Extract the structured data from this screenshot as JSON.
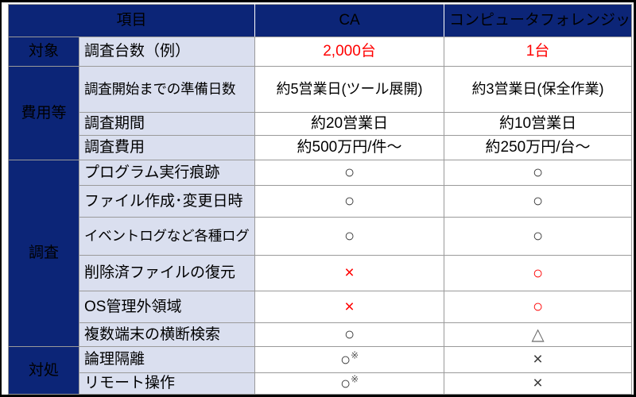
{
  "table": {
    "header": {
      "group_col": "",
      "item_col": "項目",
      "col_ca": "CA",
      "col_cf": "コンピュータフォレンジック"
    },
    "groups": {
      "target": "対象",
      "cost": "費用等",
      "investigation": "調査",
      "response": "対処"
    },
    "rows": [
      {
        "group": "対象",
        "item": "調査台数（例）",
        "ca": "2,000台",
        "cf": "1台",
        "ca_style": "red-text",
        "cf_style": "red-text"
      },
      {
        "group": "費用等",
        "item": "調査開始までの準備日数",
        "ca": "約5営業日(ツール展開)",
        "cf": "約3営業日(保全作業)",
        "ca_style": "text",
        "cf_style": "text"
      },
      {
        "group": "費用等",
        "item": "調査期間",
        "ca": "約20営業日",
        "cf": "約10営業日",
        "ca_style": "text",
        "cf_style": "text"
      },
      {
        "group": "費用等",
        "item": "調査費用",
        "ca": "約500万円/件〜",
        "cf": "約250万円/台〜",
        "ca_style": "text",
        "cf_style": "text"
      },
      {
        "group": "調査",
        "item": "プログラム実行痕跡",
        "ca": "○",
        "cf": "○",
        "ca_style": "circle-black",
        "cf_style": "circle-black"
      },
      {
        "group": "調査",
        "item": "ファイル作成･変更日時",
        "ca": "○",
        "cf": "○",
        "ca_style": "circle-black",
        "cf_style": "circle-black"
      },
      {
        "group": "調査",
        "item": "イベントログなど各種ログ",
        "ca": "○",
        "cf": "○",
        "ca_style": "circle-black",
        "cf_style": "circle-black"
      },
      {
        "group": "調査",
        "item": "削除済ファイルの復元",
        "ca": "×",
        "cf": "○",
        "ca_style": "cross-red",
        "cf_style": "circle-red"
      },
      {
        "group": "調査",
        "item": "OS管理外領域",
        "ca": "×",
        "cf": "○",
        "ca_style": "cross-red",
        "cf_style": "circle-red"
      },
      {
        "group": "調査",
        "item": "複数端末の横断検索",
        "ca": "○",
        "cf": "△",
        "ca_style": "circle-black",
        "cf_style": "triangle-gray"
      },
      {
        "group": "対処",
        "item": "論理隔離",
        "ca": "○",
        "ca_note": "※",
        "cf": "×",
        "ca_style": "circle-black-note",
        "cf_style": "cross-black"
      },
      {
        "group": "対処",
        "item": "リモート操作",
        "ca": "○",
        "ca_note": "※",
        "cf": "×",
        "ca_style": "circle-black-note",
        "cf_style": "cross-black"
      }
    ]
  },
  "colors": {
    "header_navy": "#0C2577",
    "item_light_blue": "#DADFEF",
    "accent_red": "#FF0000",
    "grid_gray": "#9A9A9A",
    "mark_dark": "#3A3A3A",
    "triangle_gray": "#6B6B6B"
  }
}
